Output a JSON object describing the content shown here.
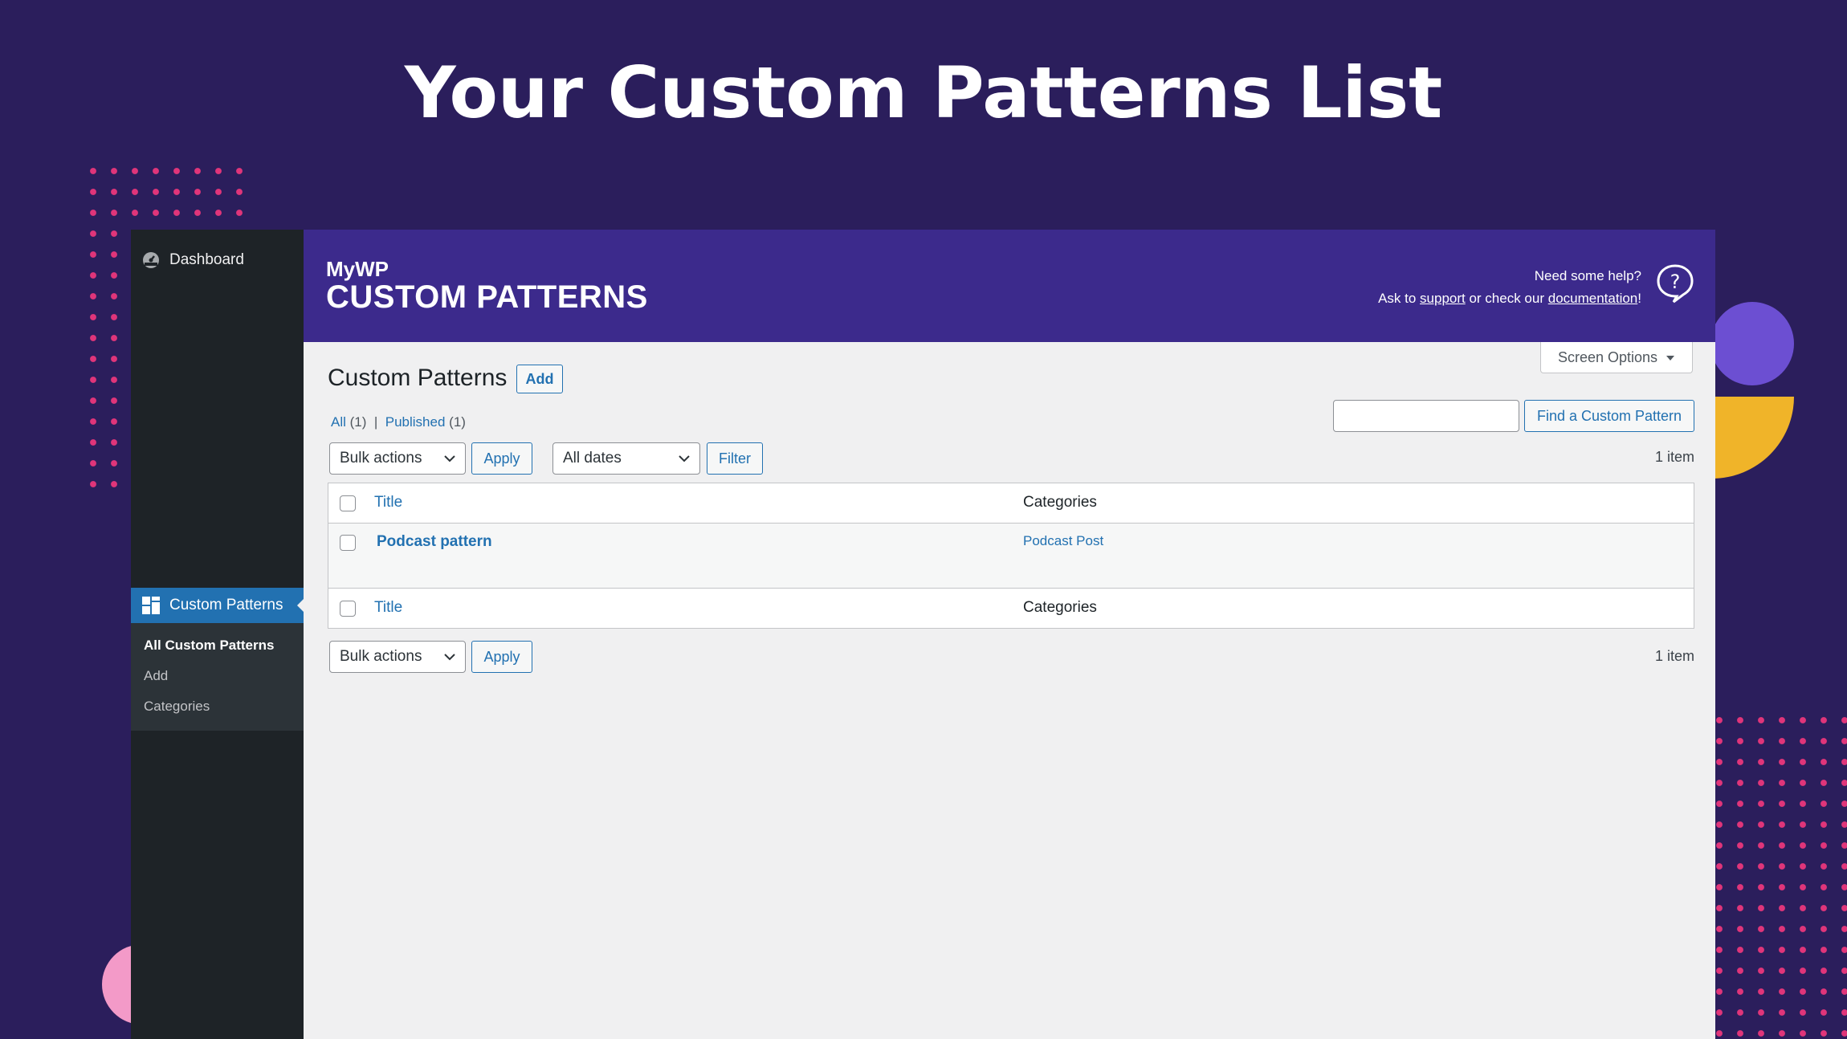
{
  "slide": {
    "headline": "Your Custom Patterns List"
  },
  "sidebar": {
    "dashboard_label": "Dashboard",
    "custom_patterns_label": "Custom Patterns",
    "submenu": [
      "All Custom Patterns",
      "Add",
      "Categories"
    ]
  },
  "banner": {
    "brand_small": "MyWP",
    "brand_big": "CUSTOM PATTERNS",
    "help_line1": "Need some help?",
    "help_ask": "Ask to ",
    "help_support": "support",
    "help_middle": " or check our ",
    "help_docs": "documentation",
    "help_end": "!"
  },
  "screen_options": {
    "label": "Screen Options",
    "icon": "caret-down-icon"
  },
  "page": {
    "title": "Custom Patterns",
    "add_label": "Add",
    "views": {
      "all": "All",
      "all_count": "(1)",
      "separator": "|",
      "published": "Published",
      "published_count": "(1)"
    },
    "search": {
      "value": "",
      "button": "Find a Custom Pattern"
    }
  },
  "tablenav_top": {
    "bulk_actions": "Bulk actions",
    "apply": "Apply",
    "dates": "All dates",
    "filter": "Filter",
    "count": "1 item"
  },
  "table": {
    "columns": [
      "Title",
      "Categories"
    ],
    "rows": [
      {
        "title": "Podcast pattern",
        "category": "Podcast Post"
      }
    ]
  },
  "tablenav_bottom": {
    "bulk_actions": "Bulk actions",
    "apply": "Apply",
    "count": "1 item"
  },
  "colors": {
    "background": "#2b1e5c",
    "banner": "#3c2a8c",
    "accent": "#2271b1",
    "sidebar": "#1e2327",
    "dots": "#e0357a",
    "purple_blob": "#6c4fd2",
    "yellow_blob": "#f0b429",
    "pink_blob": "#f39ac8"
  }
}
